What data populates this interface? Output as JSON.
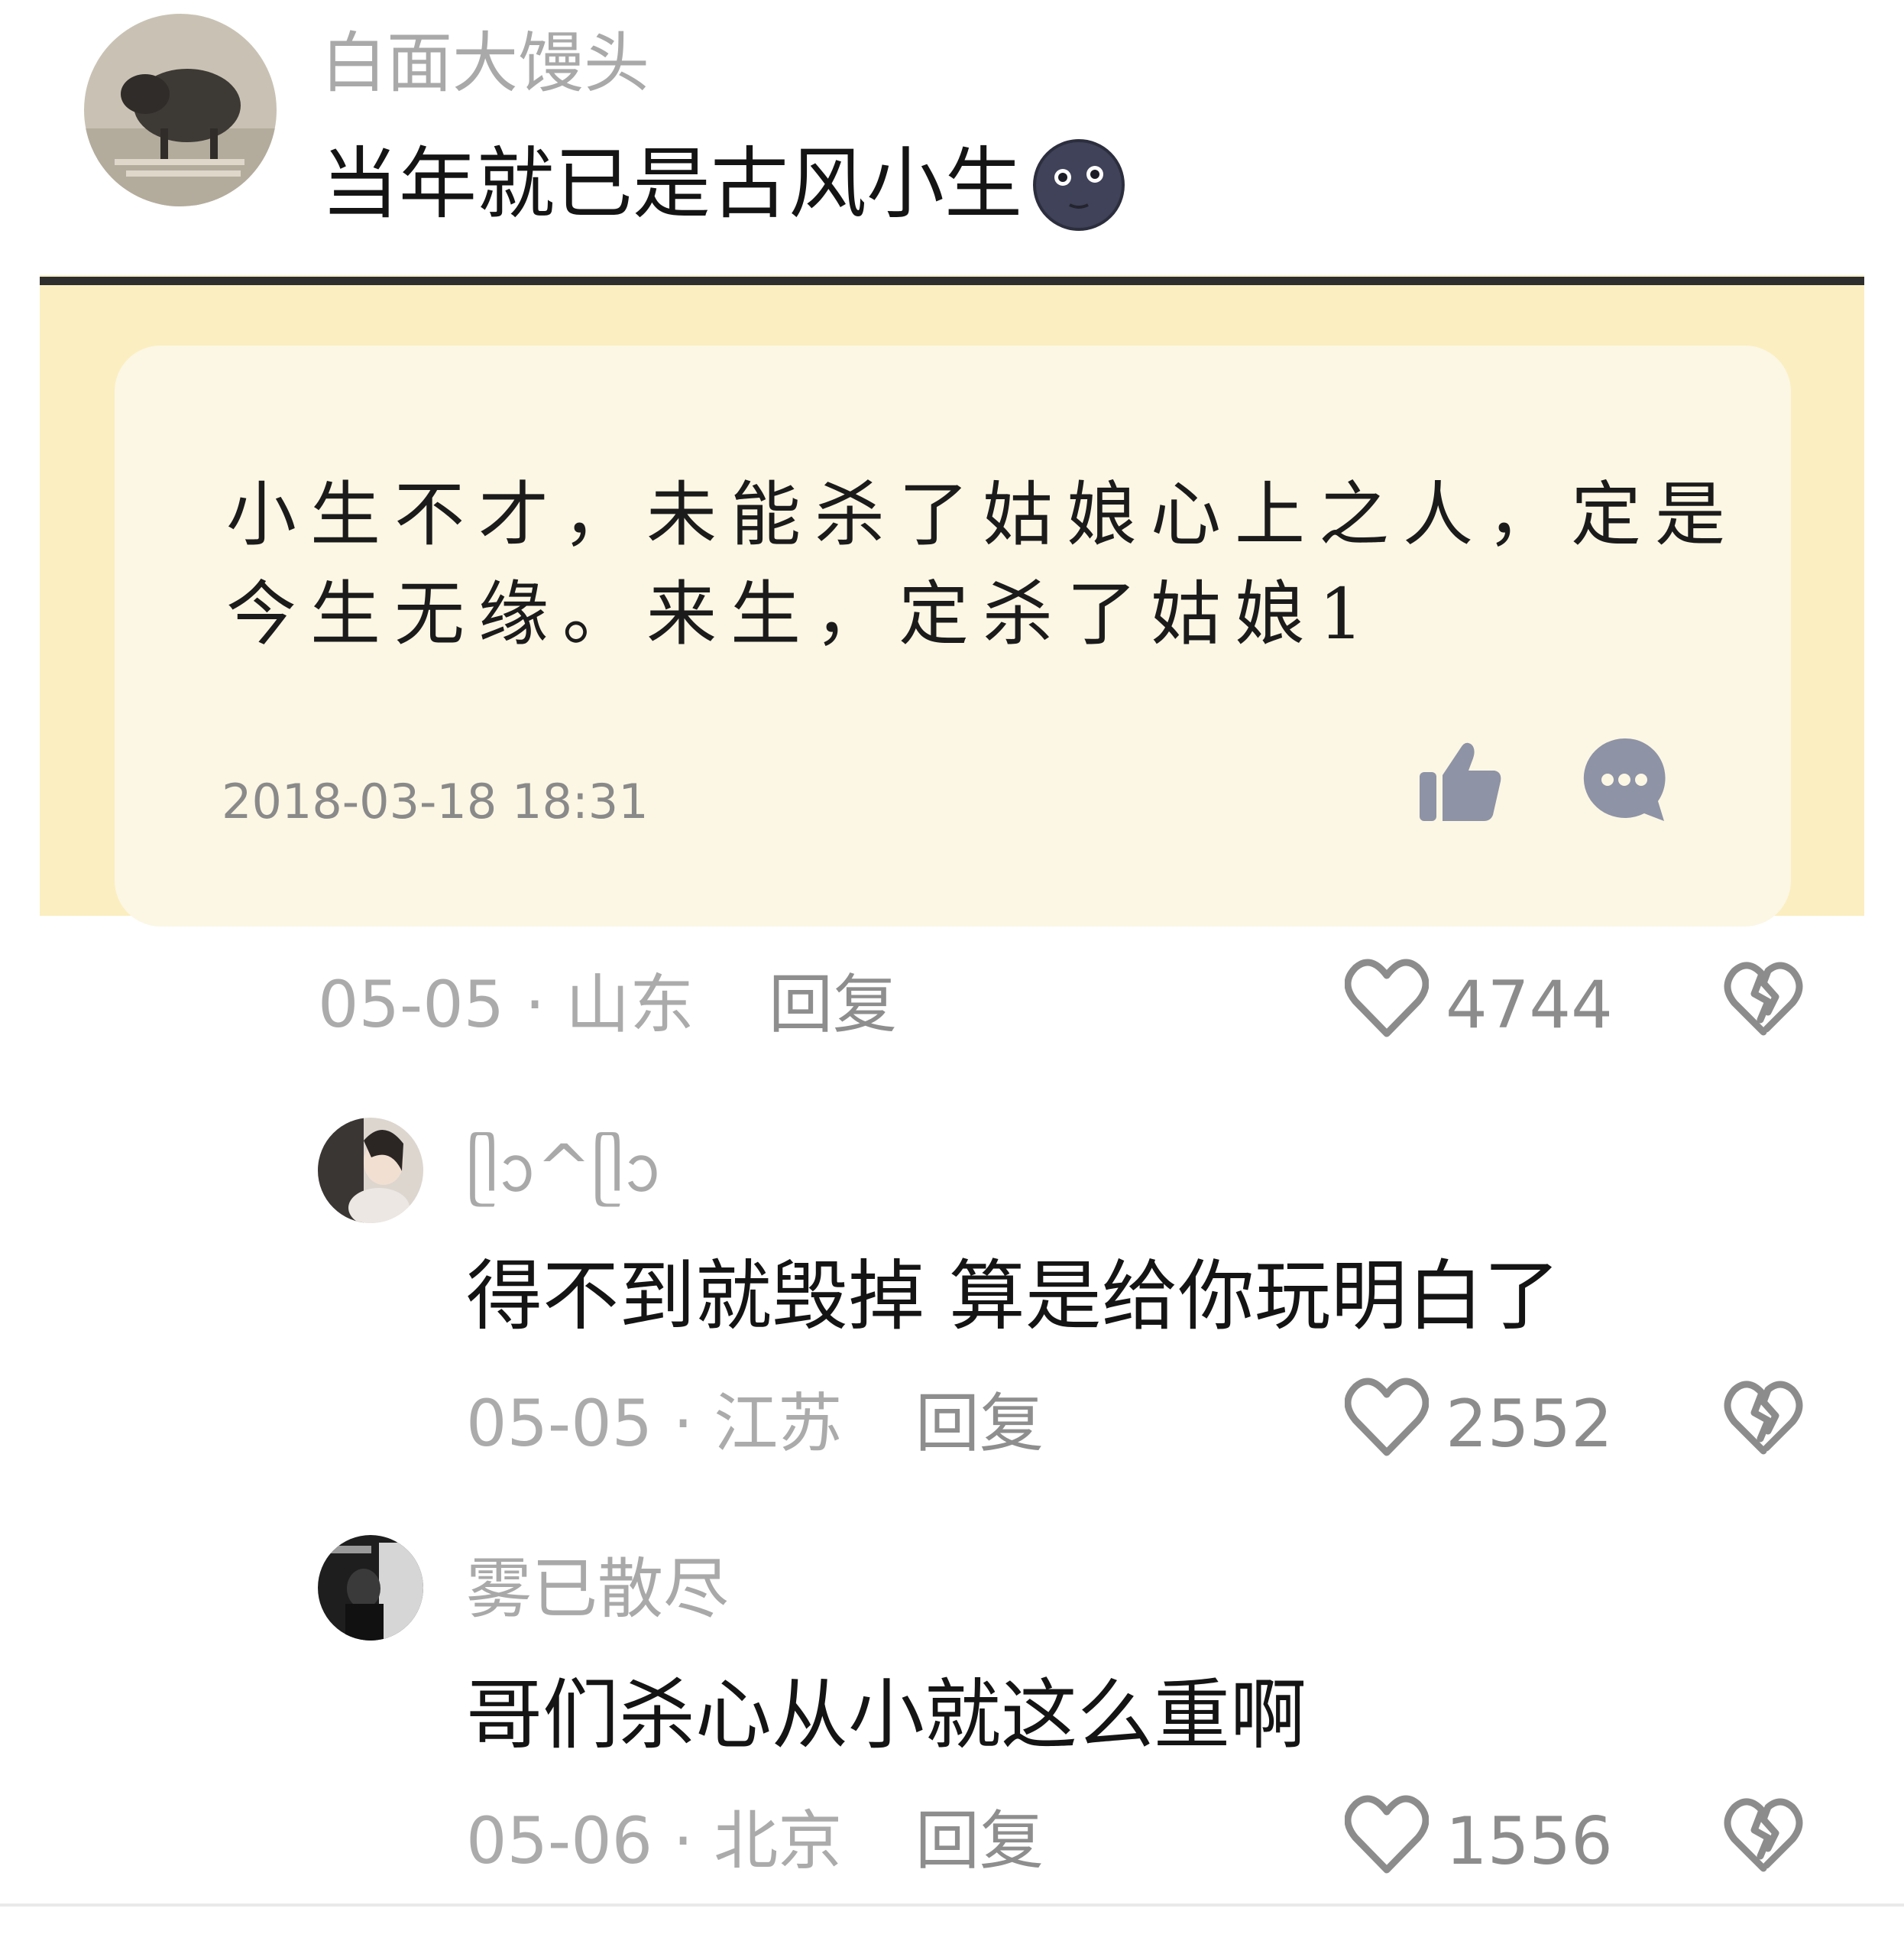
{
  "main_comment": {
    "username": "白面大馒头",
    "text": "当年就已是古风小生",
    "emoji_icon": "new-moon-face-icon",
    "embed": {
      "text_line1": "小生不才，未能杀了姑娘心上之人，定是",
      "text_line2": "今生无缘。来生，定杀了姑娘1",
      "timestamp": "2018-03-18 18:31",
      "like_icon": "thumbs-up-icon",
      "comment_icon": "chat-bubble-icon"
    },
    "date_location": "05-05 · 山东",
    "reply_label": "回复",
    "likes": "4744"
  },
  "replies": [
    {
      "username": "ᥫᩣ^ᥫᩣ",
      "text": "得不到就毁掉 算是给你玩明白了",
      "date_location": "05-05 · 江苏",
      "reply_label": "回复",
      "likes": "2552"
    },
    {
      "username": "雾已散尽",
      "text": "哥们杀心从小就这么重啊",
      "date_location": "05-06 · 北京",
      "reply_label": "回复",
      "likes": "1556"
    }
  ],
  "colors": {
    "embed_background": "#fbeec0",
    "card_background": "#fcf7e4",
    "icon_gray": "#8e93a6"
  }
}
